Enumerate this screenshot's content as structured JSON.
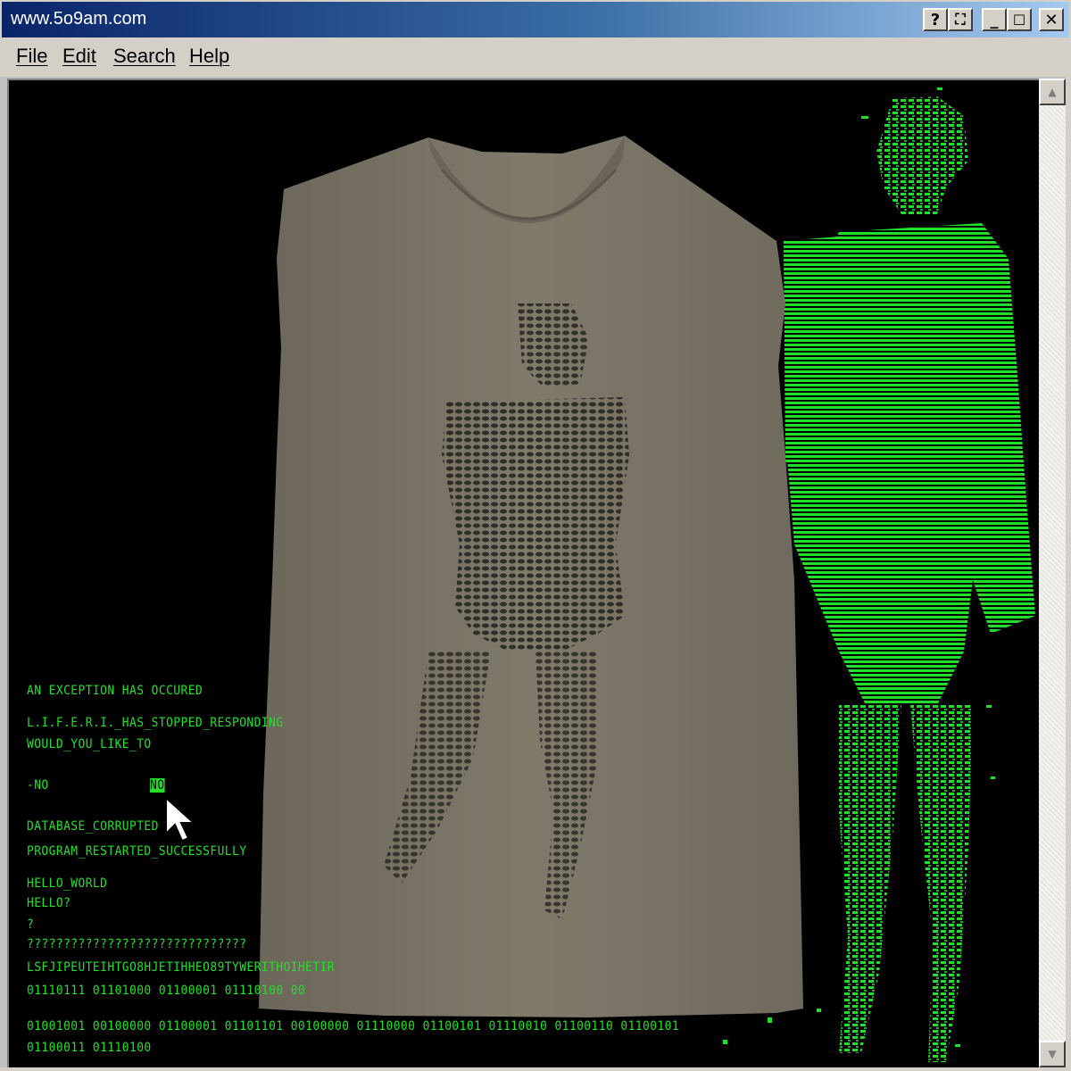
{
  "window": {
    "title": "www.5o9am.com",
    "buttons": {
      "help": "?",
      "context": "⛶",
      "minimize": "_",
      "maximize": "☐",
      "close": "✕"
    }
  },
  "menu": {
    "items": [
      "File",
      "Edit",
      "Search",
      "Help"
    ]
  },
  "terminal": {
    "lines": [
      "AN EXCEPTION HAS OCCURED",
      "L.I.F.E.R.I._HAS_STOPPED_RESPONDING",
      "WOULD_YOU_LIKE_TO",
      "-NO",
      "NO",
      "DATABASE_CORRUPTED",
      "PROGRAM_RESTARTED_SUCCESSFULLY",
      "HELLO_WORLD",
      "HELLO?",
      "?",
      "??????????????????????????????",
      "LSFJIPEUTEIHTGO8HJETIHHEO89TYWERITHOIHETIR",
      "01110111 01101000 01100001 01110100 00",
      "01001001 00100000 01100001 01101101 00100000 01110000 01100101 01110010 01100110 01100101",
      "01100011 01110100"
    ]
  },
  "colors": {
    "terminal_green": "#22e02a",
    "shirt": "#7a7566",
    "background": "#000000",
    "title_gradient_start": "#0a246a"
  }
}
